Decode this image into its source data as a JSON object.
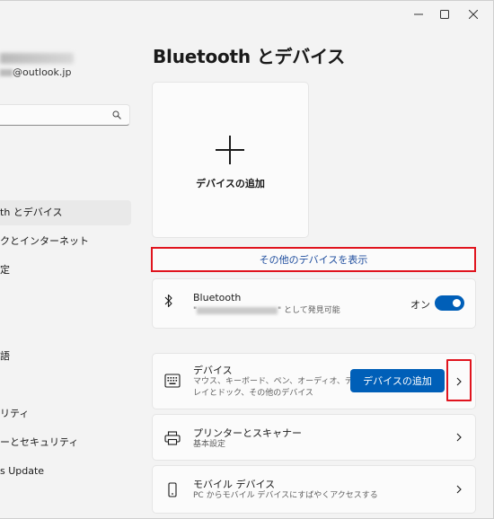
{
  "window": {
    "controls": [
      "minimize",
      "maximize",
      "close"
    ]
  },
  "profile": {
    "email_suffix": "@outlook.jp"
  },
  "sidebar": {
    "items": [
      {
        "label": "th とデバイス",
        "active": true
      },
      {
        "label": "クとインターネット"
      },
      {
        "label": "定"
      },
      {
        "label": "語"
      },
      {
        "label": "リティ"
      },
      {
        "label": "ーとセキュリティ"
      },
      {
        "label": "s Update"
      }
    ]
  },
  "page": {
    "title": "Bluetooth とデバイス"
  },
  "add_card": {
    "label": "デバイスの追加"
  },
  "show_more": {
    "label": "その他のデバイスを表示"
  },
  "bluetooth": {
    "title": "Bluetooth",
    "subtitle_suffix": "\" として発見可能",
    "toggle_label": "オン",
    "enabled": true
  },
  "devices": {
    "title": "デバイス",
    "subtitle_line1": "マウス、キーボード、ペン、オーディオ、ディスプ",
    "subtitle_line2": "レイとドック、その他のデバイス",
    "add_button": "デバイスの追加"
  },
  "printers": {
    "title": "プリンターとスキャナー",
    "subtitle": "基本設定"
  },
  "mobile": {
    "title": "モバイル デバイス",
    "subtitle": "PC からモバイル デバイスにすばやくアクセスする"
  },
  "colors": {
    "accent": "#005fb8",
    "highlight_box": "#e0141e",
    "link": "#1f4e9e"
  }
}
